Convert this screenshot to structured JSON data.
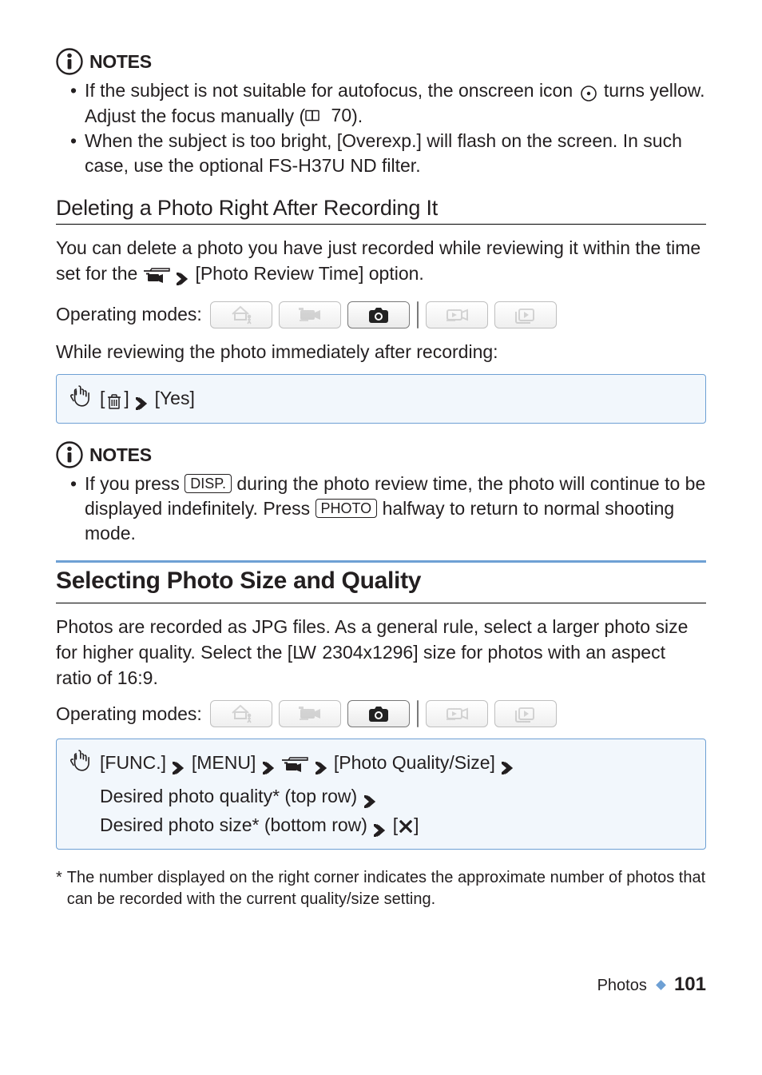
{
  "notes_label": "NOTES",
  "notes1": [
    {
      "pre": "If the subject is not suitable for autofocus, the onscreen icon ",
      "mid": " turns yellow. Adjust the focus manually (",
      "page": "70",
      "post": ")."
    },
    {
      "text": "When the subject is too bright, [Overexp.] will flash on the screen. In such case, use the optional FS-H37U ND filter."
    }
  ],
  "h2": "Deleting a Photo Right After Recording It",
  "p_delete": {
    "pre": "You can delete a photo you have just recorded while reviewing it within the time set for the ",
    "opt": " [Photo Review Time] option."
  },
  "op_label": "Operating modes:",
  "modes": {
    "icons": [
      "house-person",
      "camcorder",
      "camera",
      "camcorder-play",
      "play"
    ]
  },
  "p_review": "While reviewing the photo immediately after recording:",
  "step1": {
    "trash": "[",
    "trash_close": "]",
    "yes": "[Yes]"
  },
  "notes2": {
    "pre": "If you press ",
    "disp": "DISP.",
    "mid": " during the photo review time, the photo will continue to be displayed indefinitely. Press ",
    "photo": "PHOTO",
    "post": " halfway to return to normal shooting mode."
  },
  "h1": "Selecting Photo Size and Quality",
  "p_size": {
    "pre": "Photos are recorded as JPG files. As a general rule, select a larger photo size for higher quality. Select the [",
    "lw": "LW",
    "dim": " 2304x1296] size for photos with an aspect ratio of 16:9."
  },
  "step2": {
    "func": "[FUNC.]",
    "menu": "[MENU]",
    "qs": "[Photo Quality/Size]",
    "row1": "Desired photo quality* (top row)",
    "row2": "Desired photo size* (bottom row)",
    "close": "[",
    "close2": "]"
  },
  "footnote": "The number displayed on the right corner indicates the approximate number of photos that can be recorded with the current quality/size setting.",
  "footer_section": "Photos",
  "footer_page": "101"
}
